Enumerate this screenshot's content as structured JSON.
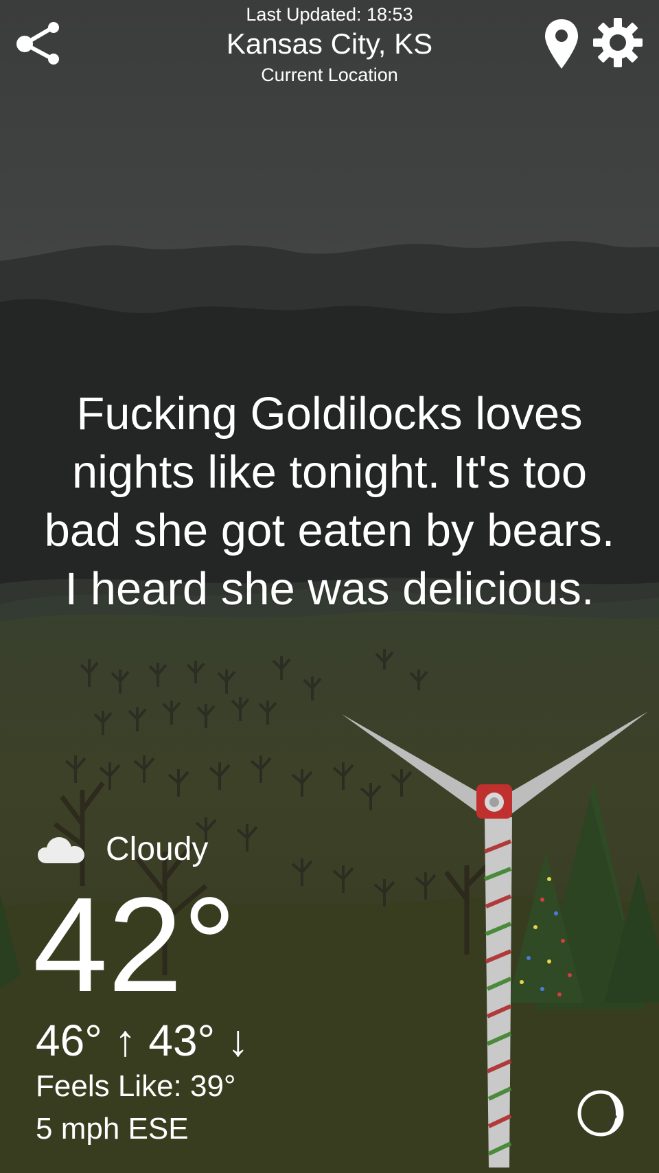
{
  "header": {
    "last_updated": "Last Updated: 18:53",
    "city": "Kansas City, KS",
    "location_label": "Current Location",
    "share_icon": "share-icon",
    "location_icon": "location-pin-icon",
    "settings_icon": "gear-icon"
  },
  "message": "Fucking Goldilocks loves nights like tonight. It's too bad she got eaten by bears. I heard she was delicious.",
  "weather": {
    "condition_icon": "cloud-icon",
    "condition": "Cloudy",
    "temperature": "42°",
    "high": "46°",
    "high_arrow": "↑",
    "low": "43°",
    "low_arrow": "↓",
    "feels_like": "Feels Like: 39°",
    "wind": "5 mph ESE"
  },
  "moon_icon": "moon-phase-icon",
  "colors": {
    "sky_top": "#3a3b3b",
    "sky_bottom": "#1f1f1f",
    "hills": "#3c432a",
    "text": "#ffffff"
  }
}
